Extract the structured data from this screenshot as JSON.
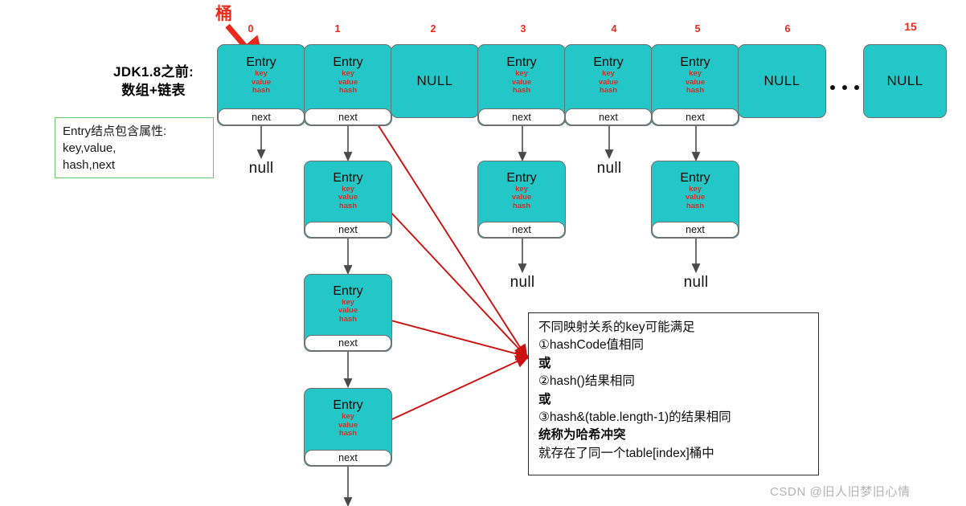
{
  "headings": {
    "main_title_line1": "JDK1.8之前:",
    "main_title_line2": "数组+链表",
    "bucket_label": "桶"
  },
  "note_green": {
    "line1": "Entry结点包含属性:",
    "line2": "key,value,",
    "line3": "hash,next"
  },
  "entry": {
    "title": "Entry",
    "field_key": "key",
    "field_value": "value",
    "field_hash": "hash",
    "next_label": "next",
    "null_label": "NULL",
    "null_terminator": "null"
  },
  "array": {
    "indices": [
      "0",
      "1",
      "2",
      "3",
      "4",
      "5",
      "6",
      "15"
    ],
    "cells": [
      {
        "index": "0",
        "type": "entry"
      },
      {
        "index": "1",
        "type": "entry"
      },
      {
        "index": "2",
        "type": "null"
      },
      {
        "index": "3",
        "type": "entry"
      },
      {
        "index": "4",
        "type": "entry"
      },
      {
        "index": "5",
        "type": "entry"
      },
      {
        "index": "6",
        "type": "null"
      },
      {
        "index": "15",
        "type": "null"
      }
    ]
  },
  "chains": {
    "bucket0": {
      "nodes": 0,
      "terminator": "null"
    },
    "bucket1": {
      "nodes": 4,
      "terminator": "continues"
    },
    "bucket3": {
      "nodes": 1,
      "terminator": "null"
    },
    "bucket4": {
      "nodes": 0,
      "terminator": "null"
    },
    "bucket5": {
      "nodes": 1,
      "terminator": "null"
    }
  },
  "explain_box": {
    "line1": "不同映射关系的key可能满足",
    "line2": "①hashCode值相同",
    "line3": "或",
    "line4": "②hash()结果相同",
    "line5": "或",
    "line6": "③hash&(table.length-1)的结果相同",
    "line7": "统称为哈希冲突",
    "line8": "就存在了同一个table[index]桶中"
  },
  "watermark": {
    "text": "CSDN @旧人旧梦旧心情"
  },
  "colors": {
    "teal": "#23c7c7",
    "red_accent": "#d1322a",
    "red_arrow": "#cc1111",
    "green_border": "#66c96b",
    "box_border": "#6f6f6f"
  }
}
